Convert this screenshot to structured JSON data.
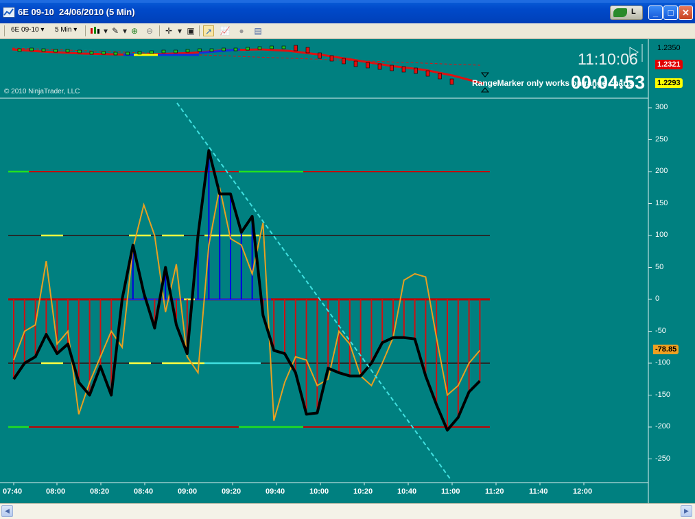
{
  "window": {
    "title": "6E 09-10  24/06/2010 (5 Min)",
    "nvidia_label": "L"
  },
  "toolbar": {
    "instrument": "6E 09-10",
    "interval": "5 Min"
  },
  "chart": {
    "copyright": "© 2010 NinjaTrader, LLC",
    "clock": "11:10:06",
    "countdown": "00:04:53",
    "rangemarker_msg": "RangeMarker only works on range charts",
    "price_labels": [
      "1.2350",
      "1.2321",
      "1.2293"
    ],
    "indicator_value": "-78.85",
    "colors": {
      "background": "#008080",
      "cci_line": "#000000",
      "fast_line": "#E8A020",
      "hist_up": "#0000E0",
      "hist_down": "#D01010",
      "level_line": "#C00000",
      "trendline": "#40E0E0"
    }
  },
  "chart_data": {
    "type": "line",
    "y_ticks": [
      "300",
      "250",
      "200",
      "150",
      "100",
      "50",
      "0",
      "-50",
      "-100",
      "-150",
      "-200",
      "-250"
    ],
    "x_ticks": [
      "07:40",
      "08:00",
      "08:20",
      "08:40",
      "09:00",
      "09:20",
      "09:40",
      "10:00",
      "10:20",
      "10:40",
      "11:00",
      "11:20",
      "11:40",
      "12:00"
    ],
    "ylim": [
      -280,
      300
    ],
    "levels": [
      200,
      100,
      0,
      -100,
      -200
    ],
    "series": [
      {
        "values": [
          -125,
          -100,
          -90,
          -55,
          -85,
          -70,
          -130,
          -150,
          -105,
          -150,
          0,
          85,
          10,
          -45,
          50,
          -40,
          -85,
          100,
          233,
          165,
          165,
          105,
          130,
          -25,
          -80,
          -85,
          -115,
          -180,
          -178,
          -108,
          -115,
          -120,
          -120,
          -100,
          -68,
          -60,
          -60,
          -62,
          -120,
          -165,
          -205,
          -185,
          -145,
          -128
        ]
      },
      {
        "values": [
          -95,
          -50,
          -40,
          60,
          -70,
          -50,
          -180,
          -130,
          -90,
          -50,
          -75,
          80,
          148,
          100,
          -20,
          55,
          -90,
          -115,
          85,
          175,
          95,
          85,
          40,
          120,
          -190,
          -130,
          -90,
          -95,
          -135,
          -125,
          -50,
          -70,
          -120,
          -135,
          -100,
          -60,
          30,
          40,
          35,
          -60,
          -150,
          -135,
          -100,
          -80,
          -80
        ]
      }
    ]
  }
}
